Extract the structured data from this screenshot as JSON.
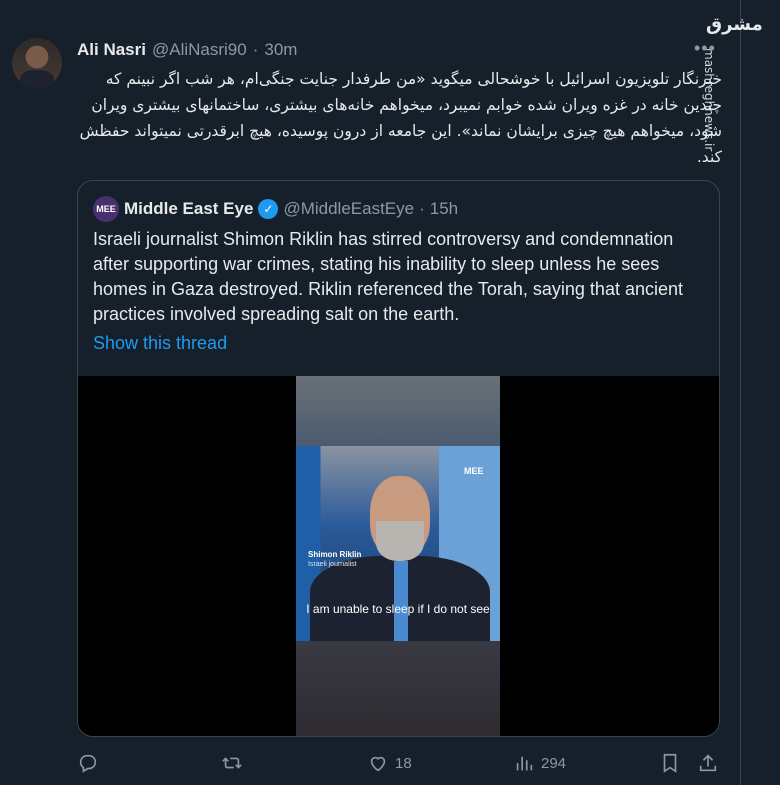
{
  "watermark": {
    "logo": "مشرق",
    "site": "mashreghnews.ir"
  },
  "tweet": {
    "author_name": "Ali Nasri",
    "handle": "@AliNasri90",
    "separator": "·",
    "time": "30m",
    "text": "خبرنگار تلویزیون اسرائیل با خوشحالی میگوید «من طرفدار جنایت جنگی‌ام، هر شب اگر نبینم که چندین خانه در غزه ویران شده خوابم نمیبرد، میخواهم خانه‌های بیشتری، ساختمانهای بیشتری ویران شود، میخواهم هیچ چیزی برایشان نماند». این جامعه از درون پوسیده، هیچ ابرقدرتی نمیتواند حفظش کند."
  },
  "quote": {
    "avatar_text": "MEE",
    "author_name": "Middle East Eye",
    "handle": "@MiddleEastEye",
    "separator": "·",
    "time": "15h",
    "text": "Israeli journalist Shimon Riklin has stirred controversy and condemnation after supporting war crimes, stating his inability to sleep unless he sees homes in Gaza destroyed. Riklin referenced the Torah, saying that ancient practices involved spreading salt on the earth.",
    "show_thread": "Show this thread",
    "video": {
      "logo": "MEE",
      "name_tag": "Shimon Riklin",
      "role_tag": "Israeli journalist",
      "caption": "I am unable to sleep if I do not see"
    }
  },
  "actions": {
    "likes": "18",
    "views": "294"
  }
}
